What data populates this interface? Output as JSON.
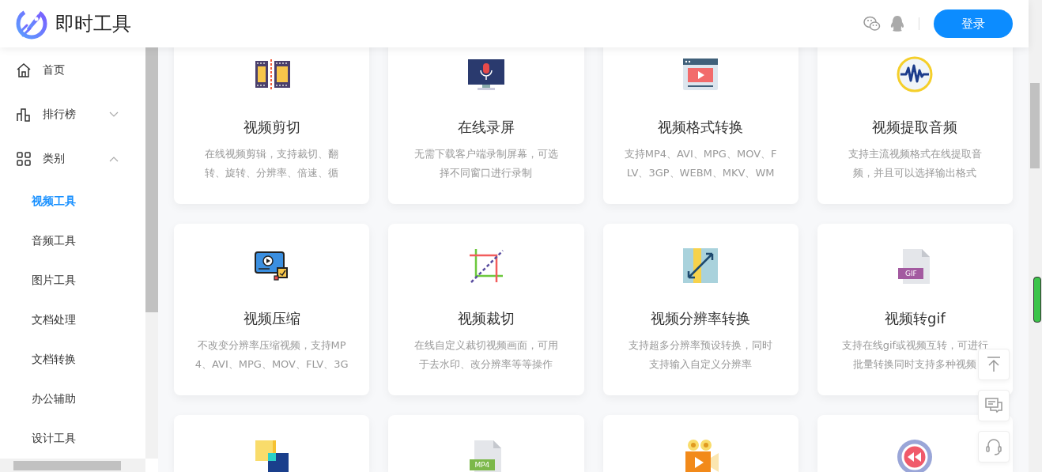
{
  "header": {
    "logo_text": "即时工具",
    "login_button": "登录"
  },
  "sidebar": {
    "items": [
      {
        "label": "首页",
        "selected": false
      },
      {
        "label": "排行榜",
        "selected": false,
        "expanded": false
      },
      {
        "label": "类别",
        "selected": false,
        "expanded": true,
        "children": [
          {
            "label": "视频工具",
            "selected": true
          },
          {
            "label": "音频工具",
            "selected": false
          },
          {
            "label": "图片工具",
            "selected": false
          },
          {
            "label": "文档处理",
            "selected": false
          },
          {
            "label": "文档转换",
            "selected": false
          },
          {
            "label": "办公辅助",
            "selected": false
          },
          {
            "label": "设计工具",
            "selected": false
          }
        ]
      }
    ]
  },
  "cards": [
    {
      "kind": "tool",
      "title": "视频剪切",
      "description": [
        "在线视频剪辑，支持裁切、翻",
        "转、旋转、分辨率、倍速、循"
      ]
    },
    {
      "kind": "tool",
      "title": "在线录屏",
      "description": [
        "无需下载客户端录制屏幕，可选",
        "择不同窗口进行录制"
      ]
    },
    {
      "kind": "tool",
      "title": "视频格式转换",
      "description": [
        "支持MP4、AVI、MPG、MOV、F",
        "LV、3GP、WEBM、MKV、WM"
      ]
    },
    {
      "kind": "tool",
      "title": "视频提取音频",
      "description": [
        "支持主流视频格式在线提取音",
        "频，并且可以选择输出格式"
      ]
    },
    {
      "kind": "tool",
      "title": "视频压缩",
      "description": [
        "不改变分辨率压缩视频，支持MP",
        "4、AVI、MPG、MOV、FLV、3G"
      ]
    },
    {
      "kind": "tool",
      "title": "视频裁切",
      "description": [
        "在线自定义裁切视频画面，可用",
        "于去水印、改分辨率等等操作"
      ]
    },
    {
      "kind": "tool",
      "title": "视频分辨率转换",
      "description": [
        "支持超多分辨率预设转换，同时",
        "支持输入自定义分辨率"
      ]
    },
    {
      "kind": "tool",
      "badge": "GIF",
      "title": "视频转gif",
      "description": [
        "支持在线gif或视频互转，可进行",
        "批量转换同时支持多种视频"
      ]
    },
    {
      "kind": "cut-off"
    },
    {
      "kind": "cut-off",
      "badge": "MP4"
    },
    {
      "kind": "cut-off"
    },
    {
      "kind": "cut-off"
    }
  ]
}
